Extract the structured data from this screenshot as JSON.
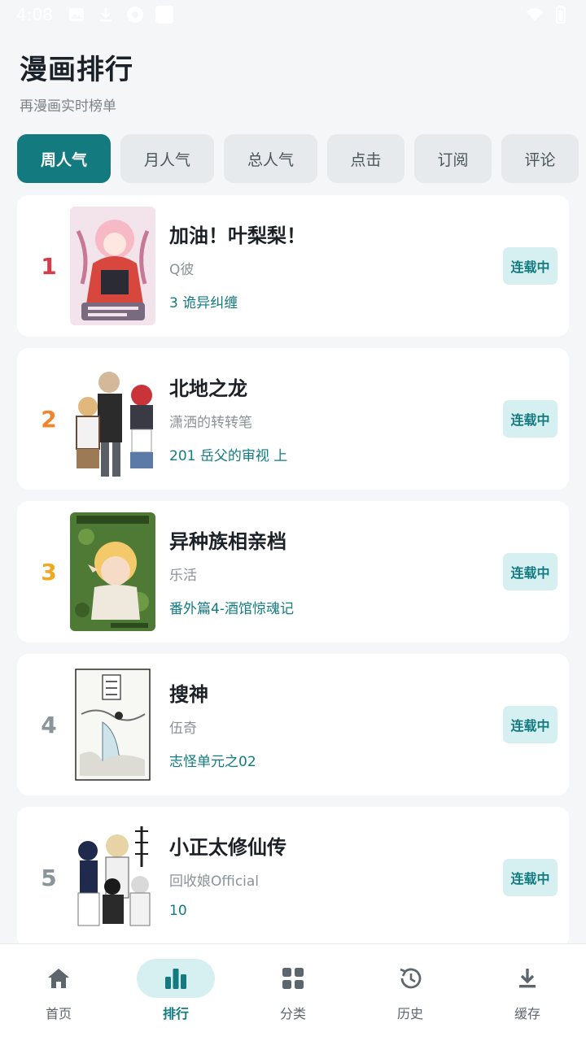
{
  "status_bar": {
    "time": "4:08",
    "left_icons": [
      "image-icon",
      "download-icon",
      "aperture-icon",
      "app-icon"
    ],
    "right_icons": [
      "wifi-icon",
      "battery-icon"
    ]
  },
  "header": {
    "title": "漫画排行",
    "subtitle": "再漫画实时榜单"
  },
  "tabs": [
    {
      "label": "周人气",
      "active": true
    },
    {
      "label": "月人气",
      "active": false
    },
    {
      "label": "总人气",
      "active": false
    },
    {
      "label": "点击",
      "active": false
    },
    {
      "label": "订阅",
      "active": false
    },
    {
      "label": "评论",
      "active": false
    }
  ],
  "rank_colors": {
    "1": "#d63b4a",
    "2": "#f0852c",
    "3": "#f0a81f",
    "4": "#8a949b",
    "5": "#8a949b"
  },
  "accent_color": "#137b80",
  "list": [
    {
      "rank": "1",
      "title": "加油！叶梨梨！",
      "author": "Q彼",
      "chapter": "3 诡异纠缠",
      "status": "连载中"
    },
    {
      "rank": "2",
      "title": "北地之龙",
      "author": "潇洒的转转笔",
      "chapter": "201 岳父的审视 上",
      "status": "连载中"
    },
    {
      "rank": "3",
      "title": "异种族相亲档",
      "author": "乐活",
      "chapter": "番外篇4-酒馆惊魂记",
      "status": "连载中"
    },
    {
      "rank": "4",
      "title": "搜神",
      "author": "伍奇",
      "chapter": "志怪单元之02",
      "status": "连载中"
    },
    {
      "rank": "5",
      "title": "小正太修仙传",
      "author": "回收娘Official",
      "chapter": "10",
      "status": "连载中"
    }
  ],
  "bottom_nav": [
    {
      "label": "首页",
      "icon": "home-icon",
      "active": false
    },
    {
      "label": "排行",
      "icon": "bar-chart-icon",
      "active": true
    },
    {
      "label": "分类",
      "icon": "grid-icon",
      "active": false
    },
    {
      "label": "历史",
      "icon": "history-icon",
      "active": false
    },
    {
      "label": "缓存",
      "icon": "download-icon",
      "active": false
    }
  ]
}
